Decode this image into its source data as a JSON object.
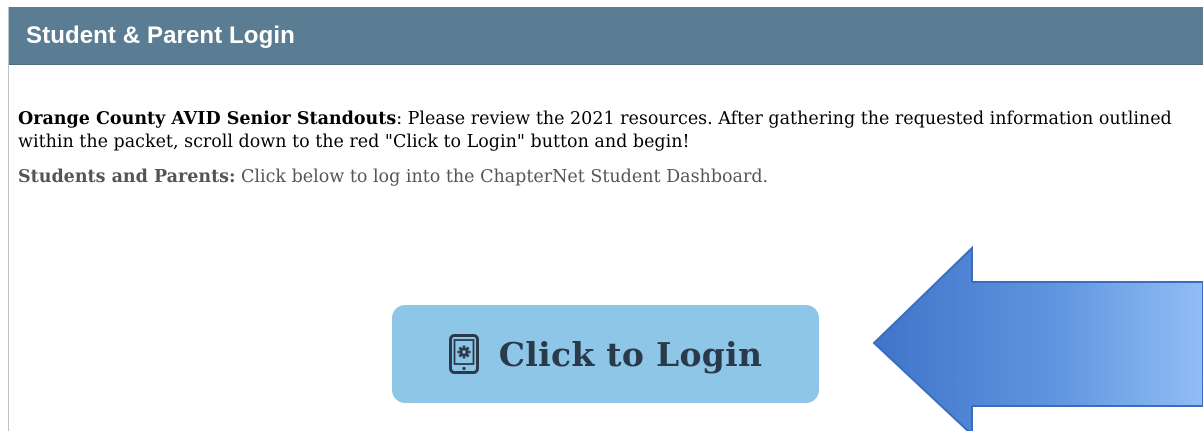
{
  "header": {
    "title": "Student & Parent Login"
  },
  "intro": {
    "bold": "Orange County AVID Senior Standouts",
    "text": ": Please review the 2021 resources.  After gathering the requested information outlined within the packet, scroll down to the red \"Click to Login\" button and begin!"
  },
  "sub": {
    "bold": "Students and Parents:",
    "text": " Click below to log into the ChapterNet Student Dashboard."
  },
  "login_button": {
    "label": "Click to Login",
    "icon": "tablet-gear-icon",
    "color": "#8ec6e8"
  },
  "annotation": {
    "icon": "arrow-left-icon",
    "color": "#4a7fd0"
  },
  "colors": {
    "header_bg": "#5b7d93",
    "header_text": "#ffffff",
    "body_text": "#000000",
    "muted_text": "#555555"
  }
}
